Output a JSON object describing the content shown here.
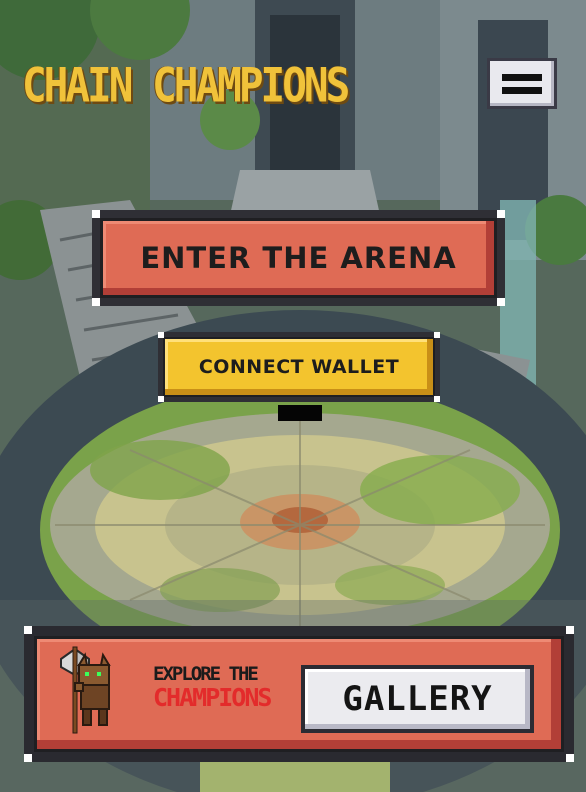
{
  "header": {
    "title": "CHAIN CHAMPIONS",
    "menu_icon": "hamburger-menu-icon"
  },
  "actions": {
    "enter_arena_label": "ENTER THE ARENA",
    "connect_wallet_label": "CONNECT WALLET"
  },
  "gallery_panel": {
    "explore_line1": "EXPLORE THE",
    "explore_line2": "CHAMPIONS",
    "gallery_button_label": "GALLERY",
    "champion_icon": "axe-warrior-champion-sprite"
  },
  "colors": {
    "title_gold": "#f0c23a",
    "button_coral": "#df6b55",
    "button_yellow": "#f3c42e",
    "champions_red": "#e32b2b"
  }
}
